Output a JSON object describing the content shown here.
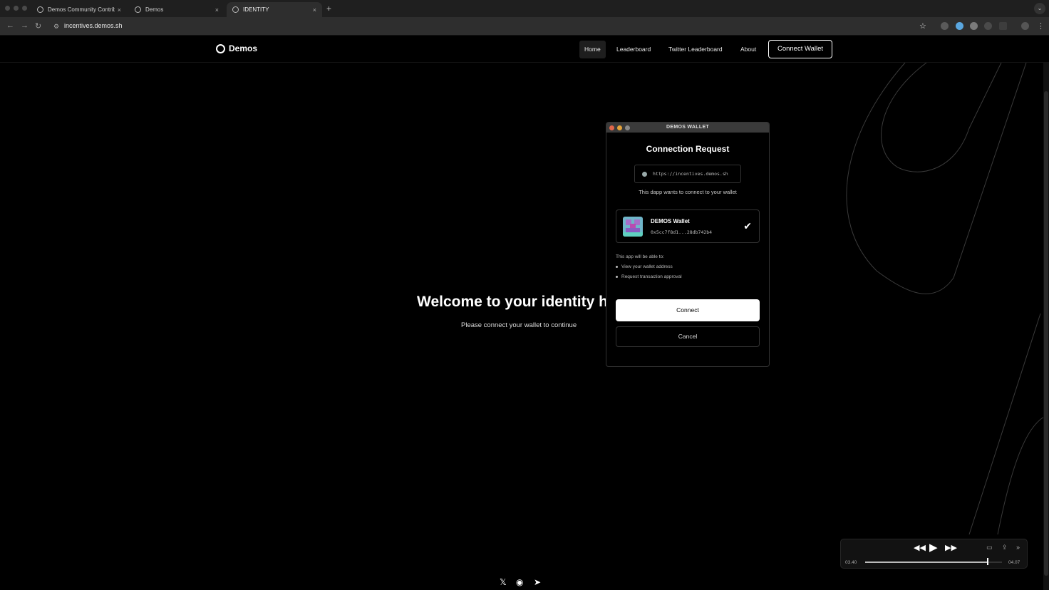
{
  "browser": {
    "tabs": [
      {
        "title": "Demos Community Contributi",
        "active": false
      },
      {
        "title": "Demos",
        "active": false
      },
      {
        "title": "IDENTITY",
        "active": true
      }
    ],
    "url": "incentives.demos.sh",
    "new_tab": "+",
    "close": "×"
  },
  "site": {
    "brand": "Demos",
    "nav": [
      "Home",
      "Leaderboard",
      "Twitter Leaderboard",
      "About"
    ],
    "connect_button": "Connect Wallet",
    "hero_title": "Welcome to your identity h",
    "hero_subtitle": "Please connect your wallet to continue",
    "social": [
      "X",
      "Discord",
      "Telegram"
    ]
  },
  "wallet": {
    "window_title": "DEMOS WALLET",
    "heading": "Connection Request",
    "origin": "https://incentives.demos.sh",
    "description": "This dapp wants to connect to your wallet",
    "account_name": "DEMOS Wallet",
    "account_address": "0x5cc7f8d1...28db742b4",
    "permissions_title": "This app will be able to:",
    "permissions": [
      "View your wallet address",
      "Request transaction approval"
    ],
    "connect_label": "Connect",
    "cancel_label": "Cancel"
  },
  "media": {
    "current_time": "03.40",
    "total_time": "04.07",
    "progress": 0.89
  },
  "colors": {
    "bg": "#000000",
    "dot_red": "#e0664a",
    "dot_yellow": "#e3a23a",
    "dot_gray": "#8a8a8a"
  }
}
